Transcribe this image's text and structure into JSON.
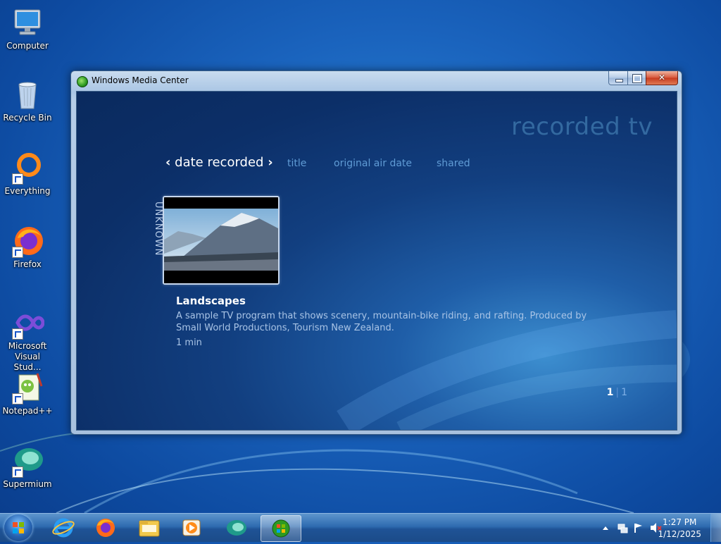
{
  "desktop": {
    "icons": [
      {
        "label": "Computer",
        "icon": "computer-icon"
      },
      {
        "label": "Recycle Bin",
        "icon": "recycle-bin-icon"
      },
      {
        "label": "Everything",
        "icon": "everything-icon"
      },
      {
        "label": "Firefox",
        "icon": "firefox-icon"
      },
      {
        "label": "Microsoft Visual Stud...",
        "icon": "visual-studio-icon"
      },
      {
        "label": "Notepad++",
        "icon": "notepad-plus-plus-icon"
      },
      {
        "label": "Supermium",
        "icon": "supermium-icon"
      }
    ]
  },
  "window": {
    "title": "Windows Media Center",
    "section_title": "recorded tv",
    "tabs": {
      "active_left": "‹",
      "active_label": "date recorded",
      "active_right": "›",
      "items": [
        "title",
        "original air date",
        "shared"
      ]
    },
    "program": {
      "group_label": "UNKNOWN",
      "title": "Landscapes",
      "description": "A sample TV program that shows scenery, mountain-bike riding, and rafting. Produced by Small World Productions, Tourism New Zealand.",
      "duration": "1 min"
    },
    "pager": {
      "current": "1",
      "separator": "|",
      "total": "1"
    }
  },
  "taskbar": {
    "items": [
      "start-orb",
      "internet-explorer-icon",
      "firefox-icon",
      "file-explorer-icon",
      "media-player-icon",
      "supermium-icon",
      "windows-media-center-icon"
    ],
    "clock_time": "1:27 PM",
    "clock_date": "1/12/2025"
  },
  "colors": {
    "desktop_blue": "#1a63bd",
    "wmc_background": "#0c2f68",
    "tab_inactive": "#5f9bd5",
    "section_title": "#3a72a8"
  }
}
